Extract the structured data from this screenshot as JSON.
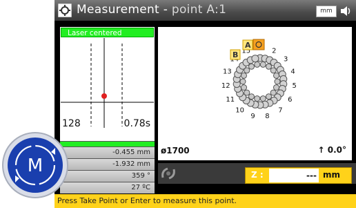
{
  "title": {
    "main": "Measurement",
    "separator": " - ",
    "point": "point A:1"
  },
  "units_badge": "mm",
  "left": {
    "status_label": "Laser centered",
    "count": "128",
    "time": "0.78s",
    "readings": [
      "-0.455 mm",
      "-1.932 mm",
      "359 °",
      "27 ºC"
    ]
  },
  "right": {
    "point_numbers": [
      "1",
      "2",
      "3",
      "4",
      "5",
      "6",
      "7",
      "8",
      "9",
      "10",
      "11",
      "12",
      "13",
      "14",
      "15"
    ],
    "marker_a": "A",
    "marker_b": "B",
    "diameter": "ø1700",
    "angle": "0.0°"
  },
  "z": {
    "label": "Z :",
    "value": "---",
    "unit": "mm"
  },
  "status_text": "Press Take Point or Enter to measure this point.",
  "logo_letter": "M",
  "colors": {
    "green": "#22ee22",
    "yellow": "#ffd21a",
    "orange": "#f5a020"
  }
}
